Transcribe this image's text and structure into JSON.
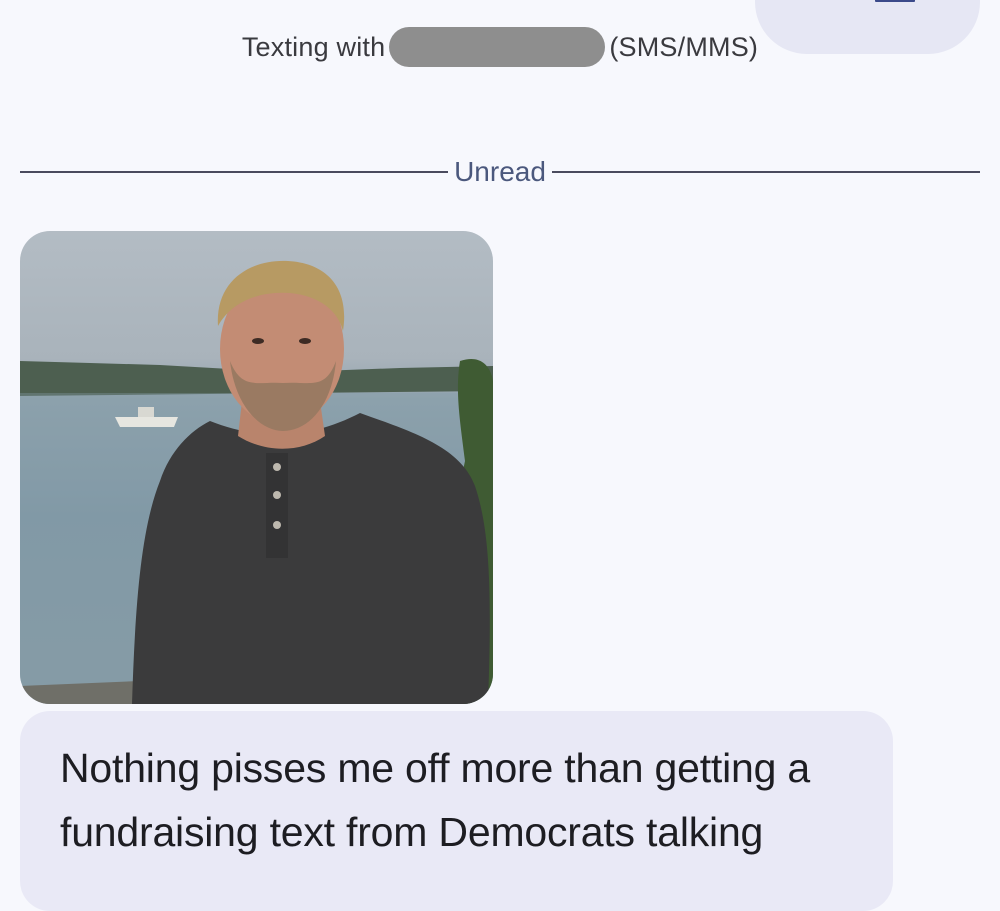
{
  "header": {
    "prefix": "Texting with",
    "contact_redacted": "",
    "suffix": "(SMS/MMS)"
  },
  "divider": {
    "label": "Unread"
  },
  "messages": [
    {
      "type": "image",
      "image_desc": "photo-attachment"
    },
    {
      "type": "text",
      "text": "Nothing pisses me off more than getting a fundraising text from Democrats talking"
    }
  ],
  "colors": {
    "background": "#f7f8fd",
    "bubble": "#e9e9f6",
    "divider": "#4a4b5e",
    "divider_label": "#4b587d",
    "corner_button": "#e6e7f4"
  },
  "icons": {
    "corner": "menu-icon"
  }
}
